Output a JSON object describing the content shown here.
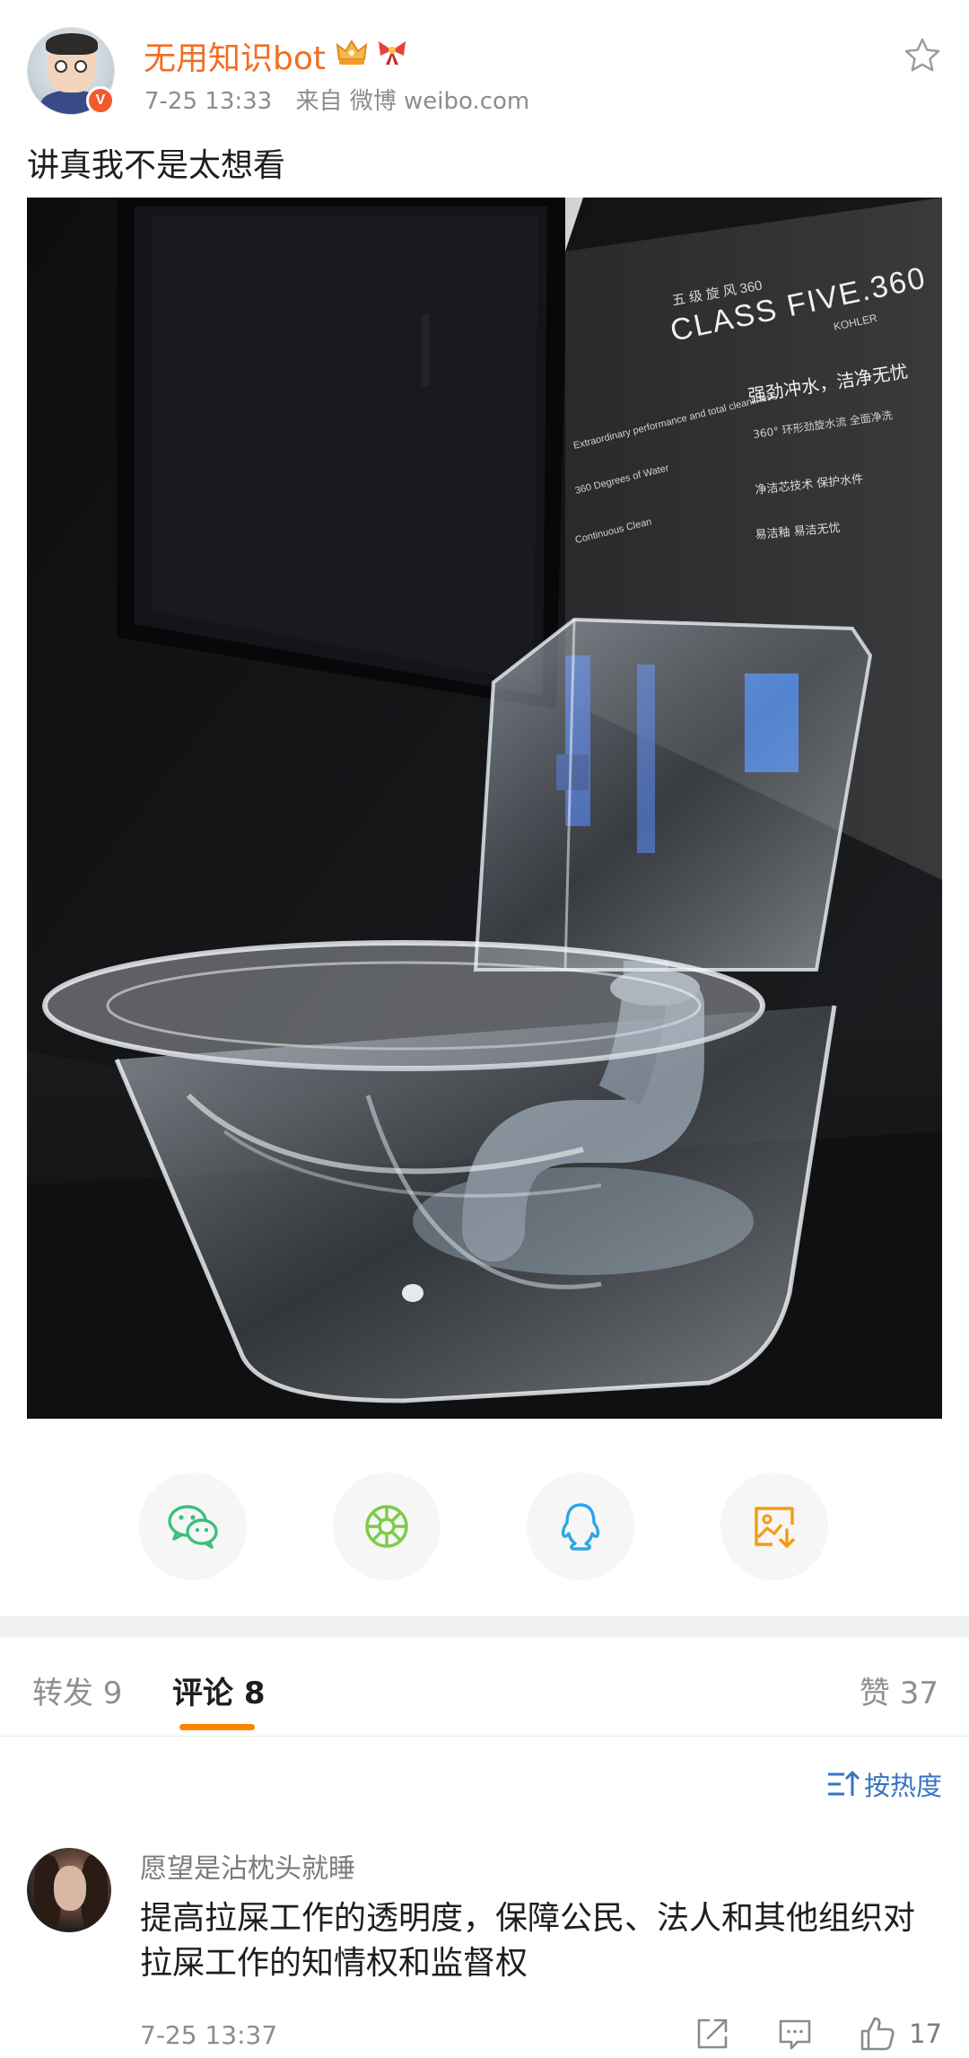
{
  "post": {
    "username": "无用知识bot",
    "verified_mark": "V",
    "time": "7-25 13:33",
    "source": "来自 微博 weibo.com",
    "text": "讲真我不是太想看"
  },
  "image_signage": {
    "brand_line": "CLASS FIVE.360",
    "brand_sub": "KOHLER",
    "cn_top": "五 级 旋 风 360",
    "cn_heading": "强劲冲水，洁净无忧",
    "cn_line_1": "360° 环形劲旋水流 全面净洗",
    "cn_line_2": "净洁芯技术 保护水件",
    "cn_line_3": "易洁釉 易洁无忧",
    "en_heading": "Extraordinary performance and total cleanliness",
    "en_line_1": "360 Degrees of Water",
    "en_line_2": "Continuous Clean"
  },
  "share_icons": [
    "wechat-icon",
    "moments-icon",
    "qq-icon",
    "save-image-icon"
  ],
  "share_colors": {
    "wechat": "#3dbf7b",
    "moments": "#7ccb48",
    "qq": "#2aa7e6",
    "save": "#f39c12"
  },
  "tabs": {
    "repost": "转发 9",
    "comments": "评论 8",
    "likes": "赞 37"
  },
  "accent_color": "#ff8200",
  "sort_label": "按热度",
  "comment": {
    "username": "愿望是沾枕头就睡",
    "text": "提高拉屎工作的透明度，保障公民、法人和其他组织对拉屎工作的知情权和监督权",
    "time": "7-25 13:37",
    "like_count": "17"
  }
}
